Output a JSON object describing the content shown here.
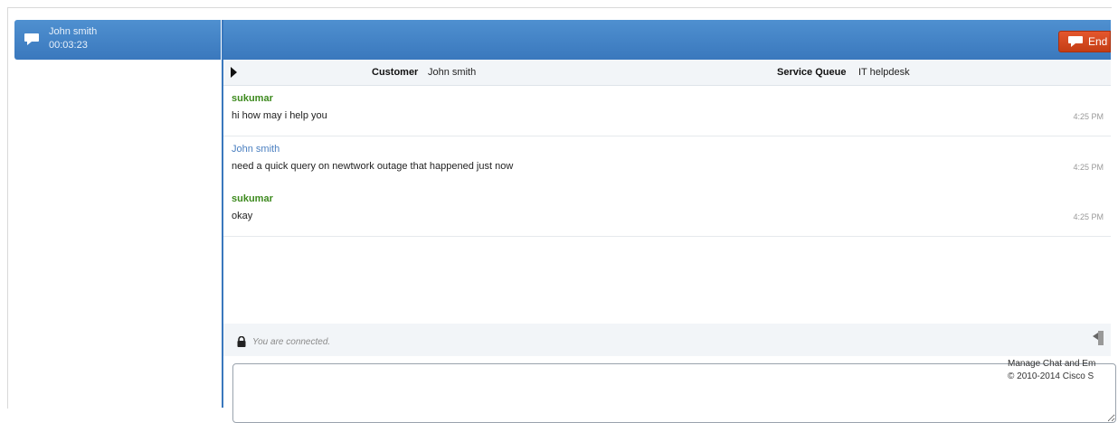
{
  "session": {
    "name": "John smith",
    "timer": "00:03:23"
  },
  "header": {
    "end_label": "End"
  },
  "info": {
    "customer_label": "Customer",
    "customer_value": "John smith",
    "queue_label": "Service Queue",
    "queue_value": "IT helpdesk"
  },
  "messages": [
    {
      "sender": "sukumar",
      "text": "hi how may i help you",
      "time": "4:25 PM"
    },
    {
      "sender": "John smith",
      "text": "need a quick query on newtwork outage that happened just now",
      "time": "4:25 PM"
    },
    {
      "sender": "sukumar",
      "text": "okay",
      "time": "4:25 PM"
    }
  ],
  "status": {
    "text": "You are connected."
  },
  "footer": {
    "line1": "Manage Chat and Em",
    "line2": "© 2010-2014 Cisco S"
  },
  "colors": {
    "header_blue": "#3a78bd",
    "end_button": "#c43d14",
    "agent_name": "#3d8a1e",
    "customer_name": "#4a7fc0"
  },
  "icons": [
    "chat-bubble-icon",
    "end-chat-icon",
    "expand-arrow-icon",
    "lock-icon",
    "settings-icon"
  ]
}
